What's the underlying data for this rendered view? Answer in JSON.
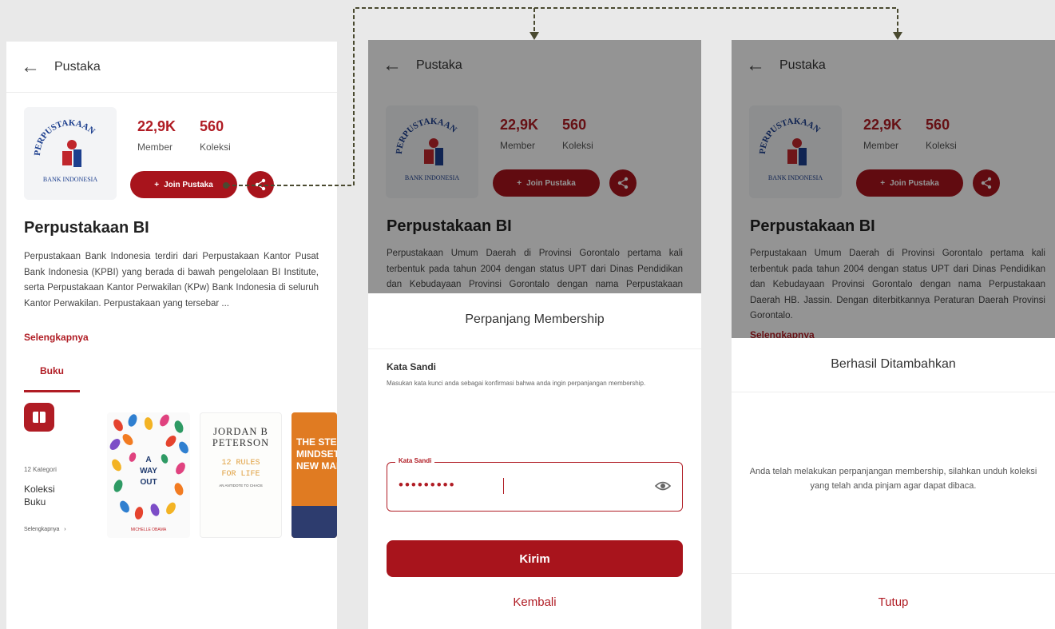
{
  "app": {
    "title": "Pustaka",
    "library_name": "Perpustakaan BI",
    "logo_text": {
      "arc": "PERPUSTAKAAN",
      "bottom": "BANK INDONESIA"
    },
    "stats": {
      "members_value": "22,9K",
      "members_label": "Member",
      "collections_value": "560",
      "collections_label": "Koleksi"
    },
    "join_label": "Join Pustaka",
    "read_more": "Selengkapnya"
  },
  "screen1": {
    "description": "Perpustakaan Bank Indonesia terdiri dari Perpustakaan Kantor Pusat Bank Indonesia (KPBI) yang berada di bawah pengelolaan BI Institute, serta Perpustakaan Kantor Perwakilan (KPw) Bank Indonesia di seluruh Kantor Perwakilan. Perpustakaan yang tersebar ...",
    "tab_label": "Buku",
    "category": {
      "count": "12 Kategori",
      "title": "Koleksi Buku",
      "more": "Selengkapnya"
    },
    "books": [
      {
        "title": "A WAY OUT",
        "author": "MICHELLE OBAMA"
      },
      {
        "author": "JORDAN B PETERSON",
        "title": "12 RULES FOR LIFE",
        "subtitle": "AN ANTIDOTE TO CHAOS"
      },
      {
        "title": "THE STEP-UP MINDSET FOR NEW MANAGERS"
      }
    ]
  },
  "background_description": "Perpustakaan Umum Daerah di Provinsi Gorontalo pertama kali terbentuk pada tahun 2004 dengan status UPT dari Dinas Pendidikan dan Kebudayaan Provinsi Gorontalo dengan nama Perpustakaan Daerah HB. Jassin. Dengan diterbitkannya Peraturan Daerah Provinsi Gorontalo.",
  "screen2": {
    "sheet_title": "Perpanjang Membership",
    "field_label": "Kata Sandi",
    "field_hint": "Masukan kata kunci anda sebagai konfirmasi bahwa anda ingin perpanjangan membership.",
    "input_label": "Kata Sandi",
    "input_value": "•••••••••",
    "submit": "Kirim",
    "back": "Kembali"
  },
  "screen3": {
    "sheet_title": "Berhasil Ditambahkan",
    "message": "Anda telah melakukan perpanjangan membership, silahkan unduh koleksi yang telah anda pinjam agar dapat dibaca.",
    "close": "Tutup"
  },
  "colors": {
    "primary": "#a8141c",
    "background": "#e9e9e9",
    "overlay": "rgba(0,0,0,0.42)",
    "connector": "#4a4a30"
  }
}
